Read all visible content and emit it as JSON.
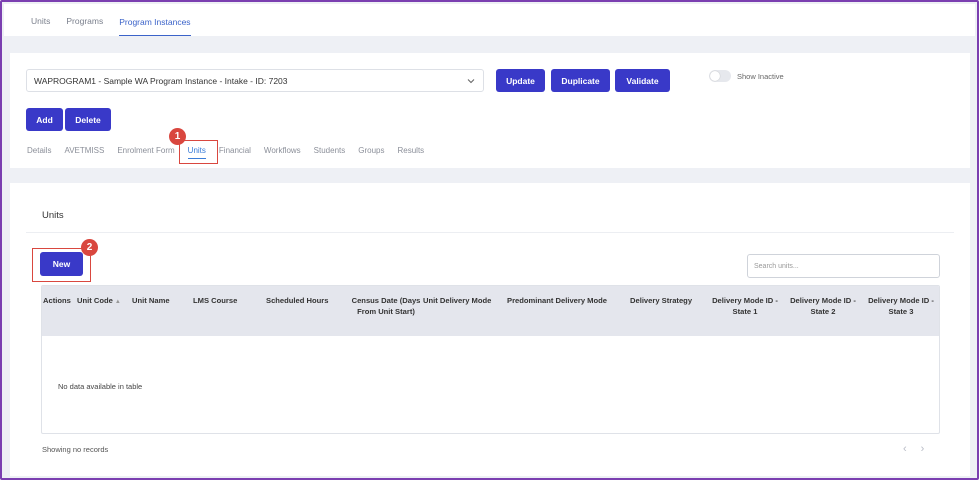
{
  "top_tabs": [
    "Units",
    "Programs",
    "Program Instances"
  ],
  "program_select": {
    "value": "WAPROGRAM1 - Sample WA Program Instance - Intake - ID: 7203"
  },
  "buttons": {
    "update": "Update",
    "duplicate": "Duplicate",
    "validate": "Validate",
    "add": "Add",
    "delete": "Delete",
    "new": "New"
  },
  "show_inactive": "Show Inactive",
  "sub_tabs": [
    "Details",
    "AVETMISS",
    "Enrolment Form",
    "Units",
    "Financial",
    "Workflows",
    "Students",
    "Groups",
    "Results"
  ],
  "annotations": [
    "1",
    "2"
  ],
  "card": {
    "title": "Units"
  },
  "search": {
    "placeholder": "Search units..."
  },
  "table": {
    "columns": [
      "Actions",
      "Unit Code",
      "Unit Name",
      "LMS Course",
      "Scheduled Hours",
      "Census Date (Days From Unit Start)",
      "Unit Delivery Mode",
      "Predominant Delivery Mode",
      "Delivery Strategy",
      "Delivery Mode ID - State 1",
      "Delivery Mode ID - State 2",
      "Delivery Mode ID - State 3"
    ],
    "empty_message": "No data available in table"
  },
  "footer": {
    "records": "Showing no records",
    "prev": "‹",
    "next": "›"
  },
  "colors": {
    "primary_button": "#3939c8",
    "highlight_box": "#d9473f",
    "frame_border": "#7b3fb0"
  }
}
